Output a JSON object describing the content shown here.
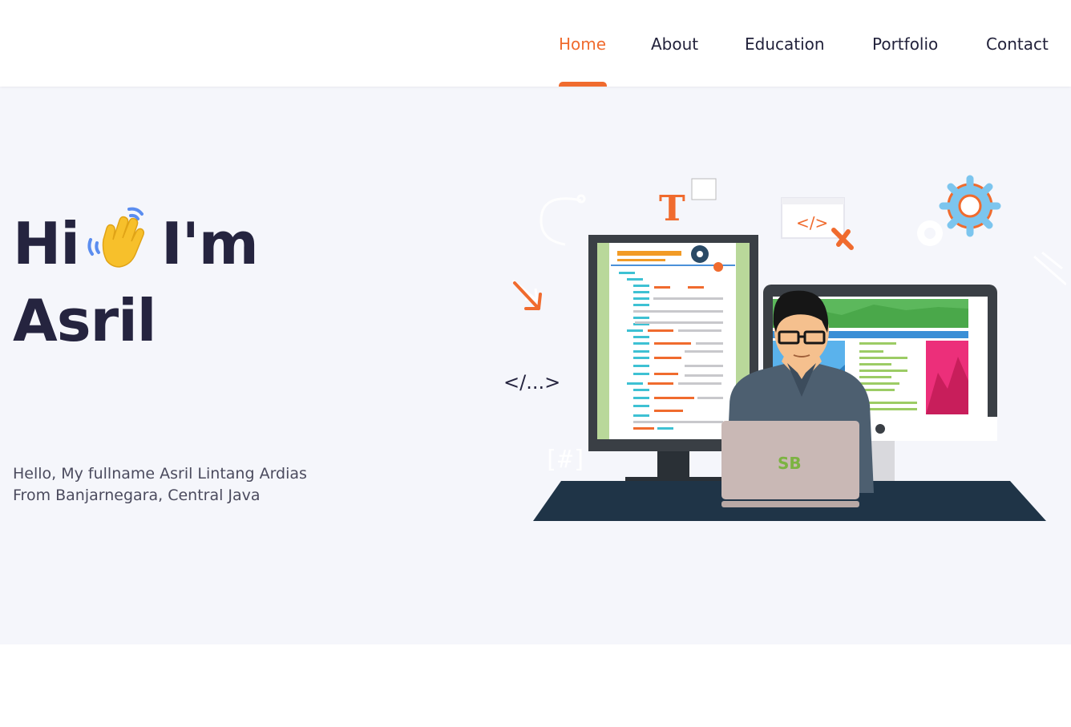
{
  "nav": {
    "items": [
      {
        "label": "Home",
        "active": true
      },
      {
        "label": "About",
        "active": false
      },
      {
        "label": "Education",
        "active": false
      },
      {
        "label": "Portfolio",
        "active": false
      },
      {
        "label": "Contact",
        "active": false
      }
    ]
  },
  "hero": {
    "greeting": "Hi",
    "wave_icon": "waving-hand-icon",
    "im": "I'm",
    "name": "Asril",
    "intro_line1": "Hello, My fullname Asril Lintang Ardias",
    "intro_line2": "From Banjarnegara, Central Java"
  },
  "illustration": {
    "code_tag": "</...>",
    "code_tag_small": "</>",
    "hash_tag": "[#]",
    "letter_t": "T",
    "laptop_logo": "SB"
  },
  "colors": {
    "accent": "#f06b2e",
    "heading": "#25243f",
    "hero_bg": "#f5f6fb",
    "desk": "#1f3447"
  }
}
